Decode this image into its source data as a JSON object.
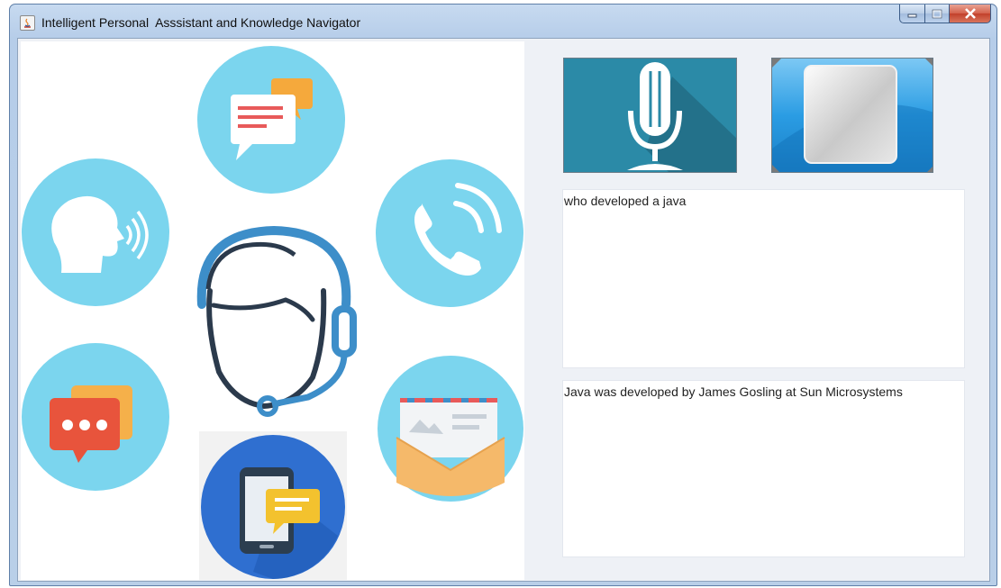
{
  "window": {
    "title": "Intelligent Personal  Asssistant and Knowledge Navigator"
  },
  "illustration": {
    "icons": [
      "chat-bubbles-icon",
      "speaking-head-icon",
      "phone-icon",
      "headset-agent-icon",
      "message-dots-icon",
      "envelope-icon",
      "mobile-chat-icon"
    ]
  },
  "controls": {
    "mic_icon": "microphone-icon",
    "stop_icon": "stop-square-icon"
  },
  "query_text": "who developed a java",
  "response_text": "Java was developed by James Gosling at Sun Microsystems",
  "colors": {
    "circle_light_blue": "#7bd5ee",
    "mic_button_bg": "#2b8aa7",
    "close_button": "#c94a33"
  }
}
